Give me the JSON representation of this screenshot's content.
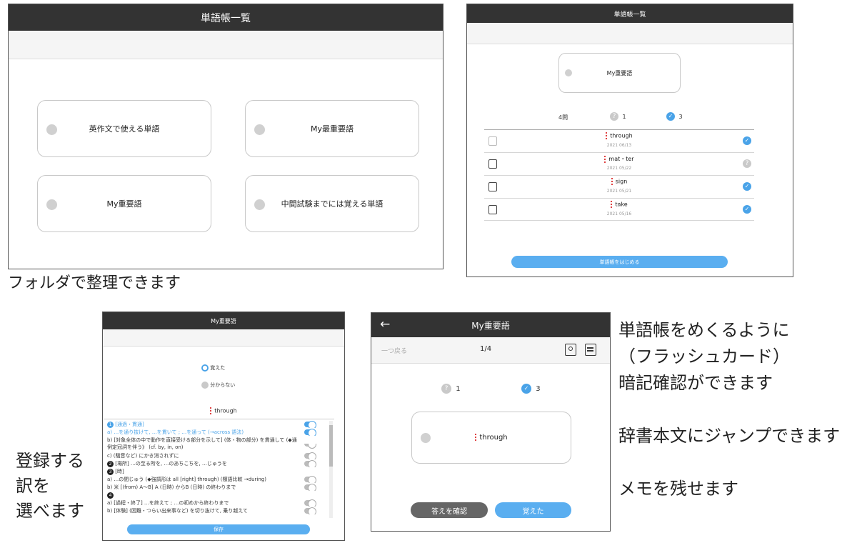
{
  "screen1": {
    "title": "単語帳一覧",
    "folders": [
      "英作文で使える単語",
      "My最重要語",
      "My重要語",
      "中間試験までには覚える単語"
    ]
  },
  "caption1": "フォルダで整理できます",
  "screen2": {
    "title": "単語帳一覧",
    "folder": "My重要語",
    "stats": {
      "total": "4問",
      "unknown": "1",
      "known": "3"
    },
    "words": [
      {
        "word": "through",
        "date": "2021 06/13",
        "status": "known"
      },
      {
        "word": "mat・ter",
        "date": "2021 05/22",
        "status": "unknown"
      },
      {
        "word": "sign",
        "date": "2021 05/21",
        "status": "known"
      },
      {
        "word": "take",
        "date": "2021 05/16",
        "status": "known"
      }
    ],
    "start_button": "単語帳をはじめる"
  },
  "screen3": {
    "title": "My重要語",
    "radio_known": "覚えた",
    "radio_unknown": "分からない",
    "word": "through",
    "meanings": [
      {
        "text": "[通過・貫通]",
        "on": true,
        "hl": true,
        "badge": "1"
      },
      {
        "text": "a) …を通り抜けて, …を貫いて ; …を通って (→across 語法)",
        "on": true,
        "hl": true
      },
      {
        "text": "b) [対象全体の中で動作を直接受ける部分を示して] (体・物の部分) を貫通して (◆通",
        "on": false,
        "hl": false
      },
      {
        "text": "例定冠詞を伴う》 (cf. by, in, on)",
        "on": false,
        "hl": false
      },
      {
        "text": "c) (騒音など) にかき消されずに",
        "on": false,
        "hl": false
      },
      {
        "text": "[場所] …の至る所を, …のあちこちを, …じゅうを",
        "on": false,
        "hl": false,
        "badge": "2"
      },
      {
        "text": "[時]",
        "on": false,
        "hl": false,
        "badge": "3"
      },
      {
        "text": "a) …の間じゅう (◆強調形は all [right] through) (類語比較 →during)",
        "on": false,
        "hl": false
      },
      {
        "text": "b) 米 [(from) A～B] A (日時) からB (日時) の終わりまで",
        "on": false,
        "hl": false
      },
      {
        "text": "",
        "on": false,
        "hl": false,
        "badge": "4"
      },
      {
        "text": "a) [過程・終了] …を終えて ; …の初めから終わりまで",
        "on": false,
        "hl": false
      },
      {
        "text": "b) [体験] (困難・つらい出来事など) を切り抜けて, 乗り越えて",
        "on": false,
        "hl": false
      }
    ],
    "save_button": "保存"
  },
  "caption3": [
    "登録する",
    "訳を",
    "選べます"
  ],
  "screen4": {
    "title": "My重要語",
    "back_label": "一つ戻る",
    "progress": "1/4",
    "unknown": "1",
    "known": "3",
    "word": "through",
    "confirm_button": "答えを確認",
    "known_button": "覚えた"
  },
  "caption4": [
    "単語帳をめくるように",
    "（フラッシュカード）",
    "暗記確認ができます",
    "辞書本文にジャンプできます",
    "メモを残せます"
  ],
  "colors": {
    "header": "#333333",
    "accent": "#5aaef0",
    "gray_button": "#666666"
  }
}
